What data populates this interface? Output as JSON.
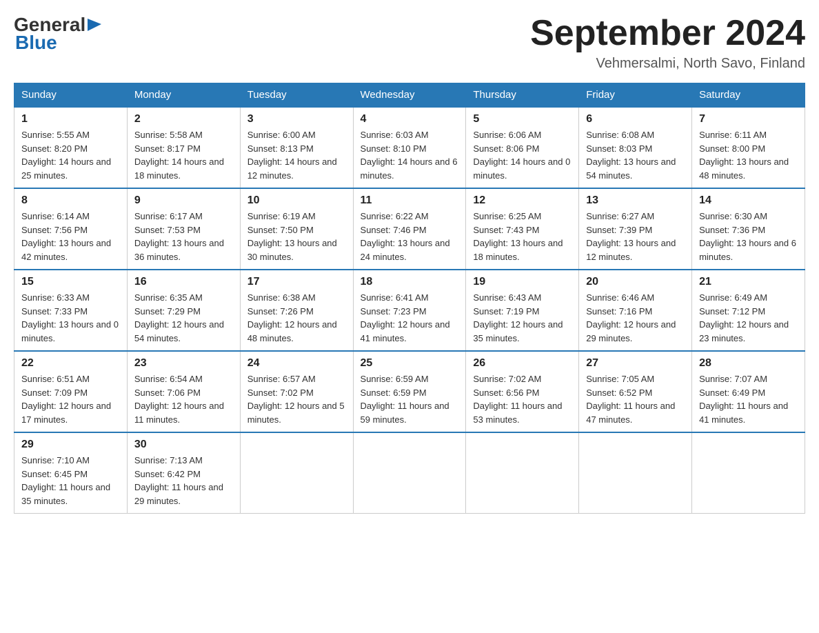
{
  "header": {
    "logo_general": "General",
    "logo_blue": "Blue",
    "title": "September 2024",
    "subtitle": "Vehmersalmi, North Savo, Finland"
  },
  "days_of_week": [
    "Sunday",
    "Monday",
    "Tuesday",
    "Wednesday",
    "Thursday",
    "Friday",
    "Saturday"
  ],
  "weeks": [
    [
      {
        "day": "1",
        "sunrise": "5:55 AM",
        "sunset": "8:20 PM",
        "daylight": "14 hours and 25 minutes."
      },
      {
        "day": "2",
        "sunrise": "5:58 AM",
        "sunset": "8:17 PM",
        "daylight": "14 hours and 18 minutes."
      },
      {
        "day": "3",
        "sunrise": "6:00 AM",
        "sunset": "8:13 PM",
        "daylight": "14 hours and 12 minutes."
      },
      {
        "day": "4",
        "sunrise": "6:03 AM",
        "sunset": "8:10 PM",
        "daylight": "14 hours and 6 minutes."
      },
      {
        "day": "5",
        "sunrise": "6:06 AM",
        "sunset": "8:06 PM",
        "daylight": "14 hours and 0 minutes."
      },
      {
        "day": "6",
        "sunrise": "6:08 AM",
        "sunset": "8:03 PM",
        "daylight": "13 hours and 54 minutes."
      },
      {
        "day": "7",
        "sunrise": "6:11 AM",
        "sunset": "8:00 PM",
        "daylight": "13 hours and 48 minutes."
      }
    ],
    [
      {
        "day": "8",
        "sunrise": "6:14 AM",
        "sunset": "7:56 PM",
        "daylight": "13 hours and 42 minutes."
      },
      {
        "day": "9",
        "sunrise": "6:17 AM",
        "sunset": "7:53 PM",
        "daylight": "13 hours and 36 minutes."
      },
      {
        "day": "10",
        "sunrise": "6:19 AM",
        "sunset": "7:50 PM",
        "daylight": "13 hours and 30 minutes."
      },
      {
        "day": "11",
        "sunrise": "6:22 AM",
        "sunset": "7:46 PM",
        "daylight": "13 hours and 24 minutes."
      },
      {
        "day": "12",
        "sunrise": "6:25 AM",
        "sunset": "7:43 PM",
        "daylight": "13 hours and 18 minutes."
      },
      {
        "day": "13",
        "sunrise": "6:27 AM",
        "sunset": "7:39 PM",
        "daylight": "13 hours and 12 minutes."
      },
      {
        "day": "14",
        "sunrise": "6:30 AM",
        "sunset": "7:36 PM",
        "daylight": "13 hours and 6 minutes."
      }
    ],
    [
      {
        "day": "15",
        "sunrise": "6:33 AM",
        "sunset": "7:33 PM",
        "daylight": "13 hours and 0 minutes."
      },
      {
        "day": "16",
        "sunrise": "6:35 AM",
        "sunset": "7:29 PM",
        "daylight": "12 hours and 54 minutes."
      },
      {
        "day": "17",
        "sunrise": "6:38 AM",
        "sunset": "7:26 PM",
        "daylight": "12 hours and 48 minutes."
      },
      {
        "day": "18",
        "sunrise": "6:41 AM",
        "sunset": "7:23 PM",
        "daylight": "12 hours and 41 minutes."
      },
      {
        "day": "19",
        "sunrise": "6:43 AM",
        "sunset": "7:19 PM",
        "daylight": "12 hours and 35 minutes."
      },
      {
        "day": "20",
        "sunrise": "6:46 AM",
        "sunset": "7:16 PM",
        "daylight": "12 hours and 29 minutes."
      },
      {
        "day": "21",
        "sunrise": "6:49 AM",
        "sunset": "7:12 PM",
        "daylight": "12 hours and 23 minutes."
      }
    ],
    [
      {
        "day": "22",
        "sunrise": "6:51 AM",
        "sunset": "7:09 PM",
        "daylight": "12 hours and 17 minutes."
      },
      {
        "day": "23",
        "sunrise": "6:54 AM",
        "sunset": "7:06 PM",
        "daylight": "12 hours and 11 minutes."
      },
      {
        "day": "24",
        "sunrise": "6:57 AM",
        "sunset": "7:02 PM",
        "daylight": "12 hours and 5 minutes."
      },
      {
        "day": "25",
        "sunrise": "6:59 AM",
        "sunset": "6:59 PM",
        "daylight": "11 hours and 59 minutes."
      },
      {
        "day": "26",
        "sunrise": "7:02 AM",
        "sunset": "6:56 PM",
        "daylight": "11 hours and 53 minutes."
      },
      {
        "day": "27",
        "sunrise": "7:05 AM",
        "sunset": "6:52 PM",
        "daylight": "11 hours and 47 minutes."
      },
      {
        "day": "28",
        "sunrise": "7:07 AM",
        "sunset": "6:49 PM",
        "daylight": "11 hours and 41 minutes."
      }
    ],
    [
      {
        "day": "29",
        "sunrise": "7:10 AM",
        "sunset": "6:45 PM",
        "daylight": "11 hours and 35 minutes."
      },
      {
        "day": "30",
        "sunrise": "7:13 AM",
        "sunset": "6:42 PM",
        "daylight": "11 hours and 29 minutes."
      },
      null,
      null,
      null,
      null,
      null
    ]
  ]
}
